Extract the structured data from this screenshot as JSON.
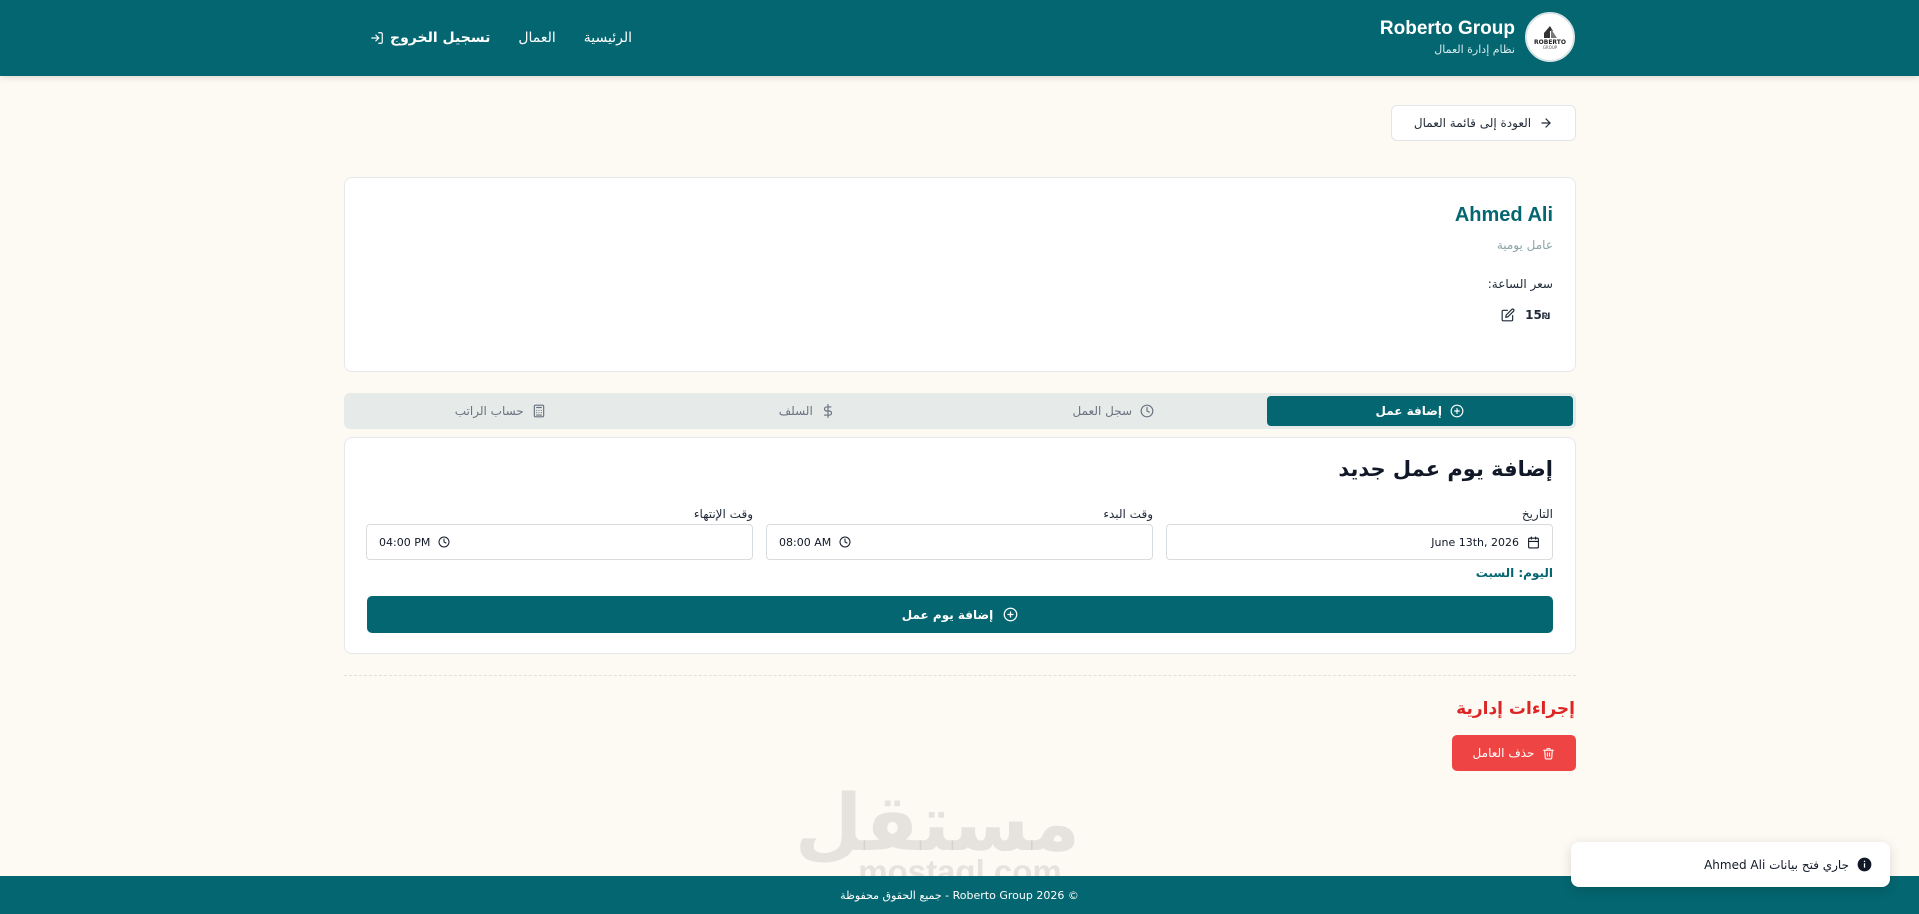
{
  "header": {
    "brand_title": "Roberto Group",
    "brand_subtitle": "نظام إدارة العمال",
    "logo_text": "ROBERTO",
    "logo_sub": "GROUP",
    "nav": {
      "home": "الرئيسية",
      "workers": "العمال",
      "logout": "تسجيل الخروج"
    }
  },
  "back_button": "العودة إلى قائمة العمال",
  "worker": {
    "name": "Ahmed Ali",
    "type": "عامل يومية",
    "rate_label": "سعر الساعة:",
    "rate_value": "15",
    "rate_currency": "₪"
  },
  "tabs": [
    {
      "label": "إضافة عمل",
      "icon": "plus-circle-icon",
      "active": true
    },
    {
      "label": "سجل العمل",
      "icon": "clock-icon",
      "active": false
    },
    {
      "label": "السلف",
      "icon": "dollar-icon",
      "active": false
    },
    {
      "label": "حساب الراتب",
      "icon": "calculator-icon",
      "active": false
    }
  ],
  "form": {
    "title": "إضافة يوم عمل جديد",
    "date_label": "التاريخ",
    "date_value": "June 13th, 2026",
    "start_label": "وقت البدء",
    "start_value": "08:00 AM",
    "end_label": "وقت الإنتهاء",
    "end_value": "04:00 PM",
    "day_label": "اليوم: السبت",
    "submit_label": "إضافة يوم عمل"
  },
  "admin": {
    "title": "إجراءات إدارية",
    "delete_label": "حذف العامل"
  },
  "watermark": {
    "arabic": "مستقل",
    "latin": "mostaql.com"
  },
  "footer": "© 2026 Roberto Group - جميع الحقوق محفوظة",
  "toast": {
    "message": "جاري فتح بيانات Ahmed Ali"
  },
  "colors": {
    "primary": "#046670",
    "background": "#fdf9f3",
    "danger": "#ef4444",
    "danger_text": "#dc2626"
  }
}
